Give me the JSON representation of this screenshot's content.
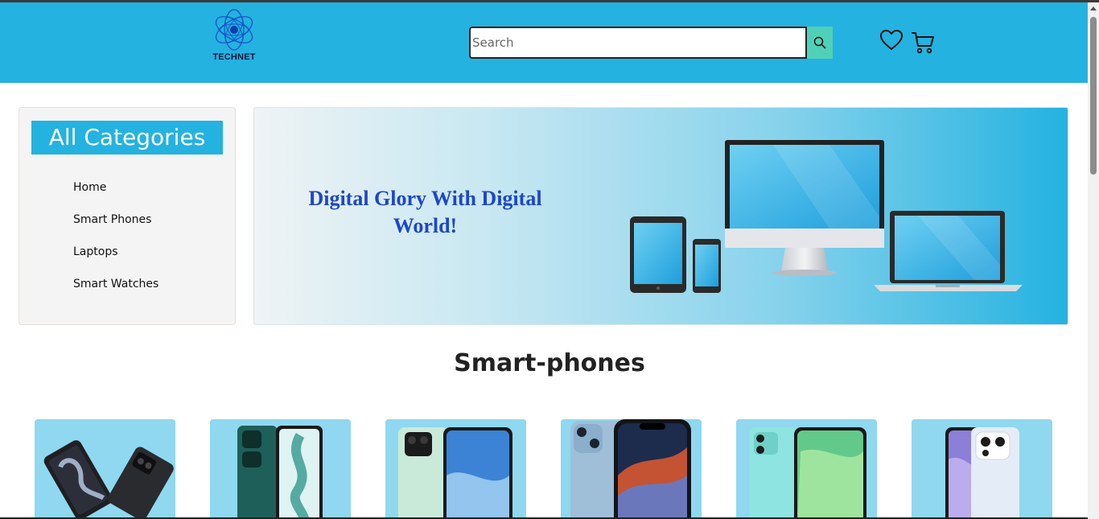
{
  "header": {
    "logo_text": "TECHNET",
    "search_placeholder": "Search",
    "search_value": "",
    "icons": [
      "search-icon",
      "heart-icon",
      "cart-icon"
    ],
    "background_color": "#24b2e0",
    "search_button_color": "#4fd1b8"
  },
  "sidebar": {
    "title": "All Categories",
    "items": [
      {
        "label": "Home"
      },
      {
        "label": "Smart Phones"
      },
      {
        "label": "Laptops"
      },
      {
        "label": "Smart Watches"
      }
    ]
  },
  "banner": {
    "headline": "Digital Glory With Digital World!",
    "headline_color": "#1d46c8"
  },
  "products": {
    "section_title": "Smart-phones",
    "card_color": "#8fd8f0",
    "items": [
      {
        "image": "foldable-phone"
      },
      {
        "image": "vivo-phone"
      },
      {
        "image": "oppo-a57-phone"
      },
      {
        "image": "iphone-14"
      },
      {
        "image": "green-phone"
      },
      {
        "image": "blue-phone"
      }
    ]
  }
}
